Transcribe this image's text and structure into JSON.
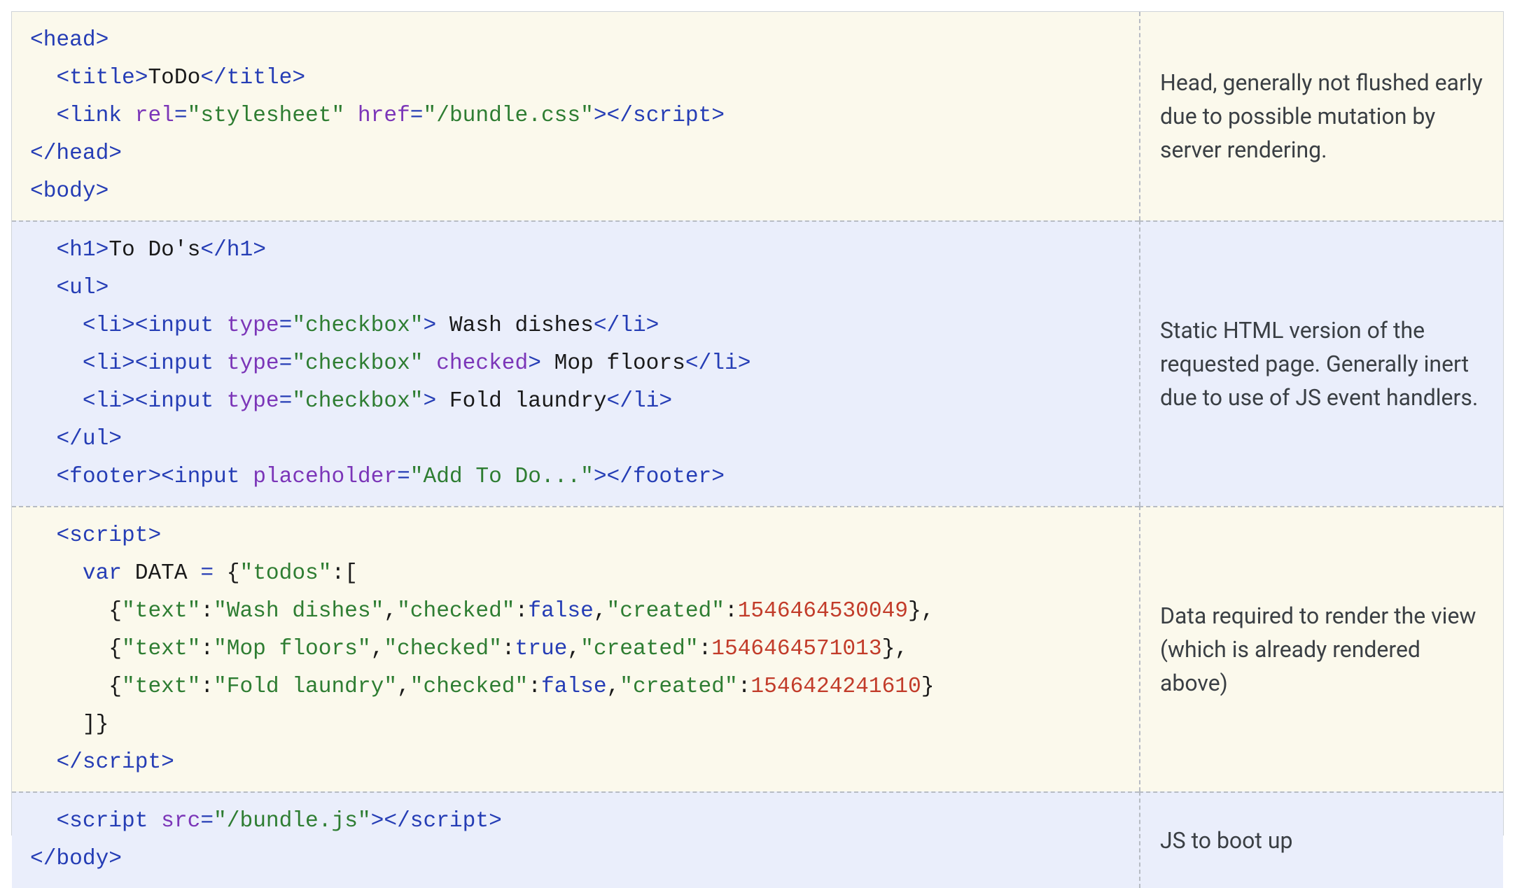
{
  "rows": [
    {
      "bg": "yellow",
      "note": "Head, generally not flushed early due to possible mutation by server rendering.",
      "code": [
        [
          {
            "t": "tag",
            "v": "<head>"
          }
        ],
        [
          {
            "t": "plain",
            "v": "  "
          },
          {
            "t": "tag",
            "v": "<title>"
          },
          {
            "t": "plain",
            "v": "ToDo"
          },
          {
            "t": "tag",
            "v": "</title>"
          }
        ],
        [
          {
            "t": "plain",
            "v": "  "
          },
          {
            "t": "tag",
            "v": "<link"
          },
          {
            "t": "plain",
            "v": " "
          },
          {
            "t": "attr",
            "v": "rel"
          },
          {
            "t": "tag",
            "v": "="
          },
          {
            "t": "str",
            "v": "\"stylesheet\""
          },
          {
            "t": "plain",
            "v": " "
          },
          {
            "t": "attr",
            "v": "href"
          },
          {
            "t": "tag",
            "v": "="
          },
          {
            "t": "str",
            "v": "\"/bundle.css\""
          },
          {
            "t": "tag",
            "v": "></script>"
          }
        ],
        [
          {
            "t": "tag",
            "v": "</head>"
          }
        ],
        [
          {
            "t": "tag",
            "v": "<body>"
          }
        ]
      ]
    },
    {
      "bg": "blue",
      "note": "Static HTML version of the requested page. Generally inert due to use of JS event handlers.",
      "code": [
        [
          {
            "t": "plain",
            "v": "  "
          },
          {
            "t": "tag",
            "v": "<h1>"
          },
          {
            "t": "plain",
            "v": "To Do's"
          },
          {
            "t": "tag",
            "v": "</h1>"
          }
        ],
        [
          {
            "t": "plain",
            "v": "  "
          },
          {
            "t": "tag",
            "v": "<ul>"
          }
        ],
        [
          {
            "t": "plain",
            "v": "    "
          },
          {
            "t": "tag",
            "v": "<li><input"
          },
          {
            "t": "plain",
            "v": " "
          },
          {
            "t": "attr",
            "v": "type"
          },
          {
            "t": "tag",
            "v": "="
          },
          {
            "t": "str",
            "v": "\"checkbox\""
          },
          {
            "t": "tag",
            "v": ">"
          },
          {
            "t": "plain",
            "v": " Wash dishes"
          },
          {
            "t": "tag",
            "v": "</li>"
          }
        ],
        [
          {
            "t": "plain",
            "v": "    "
          },
          {
            "t": "tag",
            "v": "<li><input"
          },
          {
            "t": "plain",
            "v": " "
          },
          {
            "t": "attr",
            "v": "type"
          },
          {
            "t": "tag",
            "v": "="
          },
          {
            "t": "str",
            "v": "\"checkbox\""
          },
          {
            "t": "plain",
            "v": " "
          },
          {
            "t": "attr",
            "v": "checked"
          },
          {
            "t": "tag",
            "v": ">"
          },
          {
            "t": "plain",
            "v": " Mop floors"
          },
          {
            "t": "tag",
            "v": "</li>"
          }
        ],
        [
          {
            "t": "plain",
            "v": "    "
          },
          {
            "t": "tag",
            "v": "<li><input"
          },
          {
            "t": "plain",
            "v": " "
          },
          {
            "t": "attr",
            "v": "type"
          },
          {
            "t": "tag",
            "v": "="
          },
          {
            "t": "str",
            "v": "\"checkbox\""
          },
          {
            "t": "tag",
            "v": ">"
          },
          {
            "t": "plain",
            "v": " Fold laundry"
          },
          {
            "t": "tag",
            "v": "</li>"
          }
        ],
        [
          {
            "t": "plain",
            "v": "  "
          },
          {
            "t": "tag",
            "v": "</ul>"
          }
        ],
        [
          {
            "t": "plain",
            "v": "  "
          },
          {
            "t": "tag",
            "v": "<footer><input"
          },
          {
            "t": "plain",
            "v": " "
          },
          {
            "t": "attr",
            "v": "placeholder"
          },
          {
            "t": "tag",
            "v": "="
          },
          {
            "t": "str",
            "v": "\"Add To Do...\""
          },
          {
            "t": "tag",
            "v": "></footer>"
          }
        ]
      ]
    },
    {
      "bg": "yellow",
      "note": "Data required to render the view (which is already rendered above)",
      "code": [
        [
          {
            "t": "plain",
            "v": "  "
          },
          {
            "t": "tag",
            "v": "<script>"
          }
        ],
        [
          {
            "t": "plain",
            "v": "    "
          },
          {
            "t": "kw",
            "v": "var"
          },
          {
            "t": "plain",
            "v": " DATA "
          },
          {
            "t": "tag",
            "v": "="
          },
          {
            "t": "plain",
            "v": " {"
          },
          {
            "t": "str",
            "v": "\"todos\""
          },
          {
            "t": "plain",
            "v": ":["
          }
        ],
        [
          {
            "t": "plain",
            "v": "      {"
          },
          {
            "t": "str",
            "v": "\"text\""
          },
          {
            "t": "plain",
            "v": ":"
          },
          {
            "t": "str",
            "v": "\"Wash dishes\""
          },
          {
            "t": "plain",
            "v": ","
          },
          {
            "t": "str",
            "v": "\"checked\""
          },
          {
            "t": "plain",
            "v": ":"
          },
          {
            "t": "kw",
            "v": "false"
          },
          {
            "t": "plain",
            "v": ","
          },
          {
            "t": "str",
            "v": "\"created\""
          },
          {
            "t": "plain",
            "v": ":"
          },
          {
            "t": "num",
            "v": "1546464530049"
          },
          {
            "t": "plain",
            "v": "},"
          }
        ],
        [
          {
            "t": "plain",
            "v": "      {"
          },
          {
            "t": "str",
            "v": "\"text\""
          },
          {
            "t": "plain",
            "v": ":"
          },
          {
            "t": "str",
            "v": "\"Mop floors\""
          },
          {
            "t": "plain",
            "v": ","
          },
          {
            "t": "str",
            "v": "\"checked\""
          },
          {
            "t": "plain",
            "v": ":"
          },
          {
            "t": "kw",
            "v": "true"
          },
          {
            "t": "plain",
            "v": ","
          },
          {
            "t": "str",
            "v": "\"created\""
          },
          {
            "t": "plain",
            "v": ":"
          },
          {
            "t": "num",
            "v": "1546464571013"
          },
          {
            "t": "plain",
            "v": "},"
          }
        ],
        [
          {
            "t": "plain",
            "v": "      {"
          },
          {
            "t": "str",
            "v": "\"text\""
          },
          {
            "t": "plain",
            "v": ":"
          },
          {
            "t": "str",
            "v": "\"Fold laundry\""
          },
          {
            "t": "plain",
            "v": ","
          },
          {
            "t": "str",
            "v": "\"checked\""
          },
          {
            "t": "plain",
            "v": ":"
          },
          {
            "t": "kw",
            "v": "false"
          },
          {
            "t": "plain",
            "v": ","
          },
          {
            "t": "str",
            "v": "\"created\""
          },
          {
            "t": "plain",
            "v": ":"
          },
          {
            "t": "num",
            "v": "1546424241610"
          },
          {
            "t": "plain",
            "v": "}"
          }
        ],
        [
          {
            "t": "plain",
            "v": "    ]}"
          }
        ],
        [
          {
            "t": "plain",
            "v": "  "
          },
          {
            "t": "tag",
            "v": "</script>"
          }
        ]
      ]
    },
    {
      "bg": "blue",
      "note": "JS to boot up",
      "code": [
        [
          {
            "t": "plain",
            "v": "  "
          },
          {
            "t": "tag",
            "v": "<script"
          },
          {
            "t": "plain",
            "v": " "
          },
          {
            "t": "attr",
            "v": "src"
          },
          {
            "t": "tag",
            "v": "="
          },
          {
            "t": "str",
            "v": "\"/bundle.js\""
          },
          {
            "t": "tag",
            "v": "></script>"
          }
        ],
        [
          {
            "t": "tag",
            "v": "</body>"
          }
        ]
      ]
    }
  ]
}
